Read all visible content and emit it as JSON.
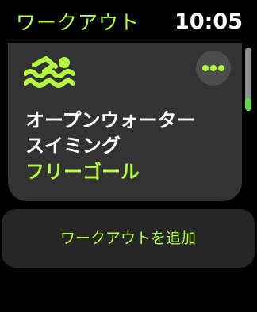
{
  "header": {
    "title": "ワークアウト",
    "time": "10:05"
  },
  "workout_card": {
    "icon": "open-water-swim-icon",
    "name": "オープンウォーター\nスイミング",
    "goal": "フリーゴール",
    "more_icon": "ellipsis-icon"
  },
  "scroll_indicator": {
    "position": "bottom"
  },
  "add_workout": {
    "label": "ワークアウトを追加"
  },
  "colors": {
    "accent": "#b4fb40",
    "background": "#000000",
    "card": "#333333",
    "add_button": "#262626",
    "text": "#ffffff",
    "more_button": "#4c4c4c",
    "scroll_track": "#8e8e8e",
    "scroll_thumb": "#58d84b"
  }
}
